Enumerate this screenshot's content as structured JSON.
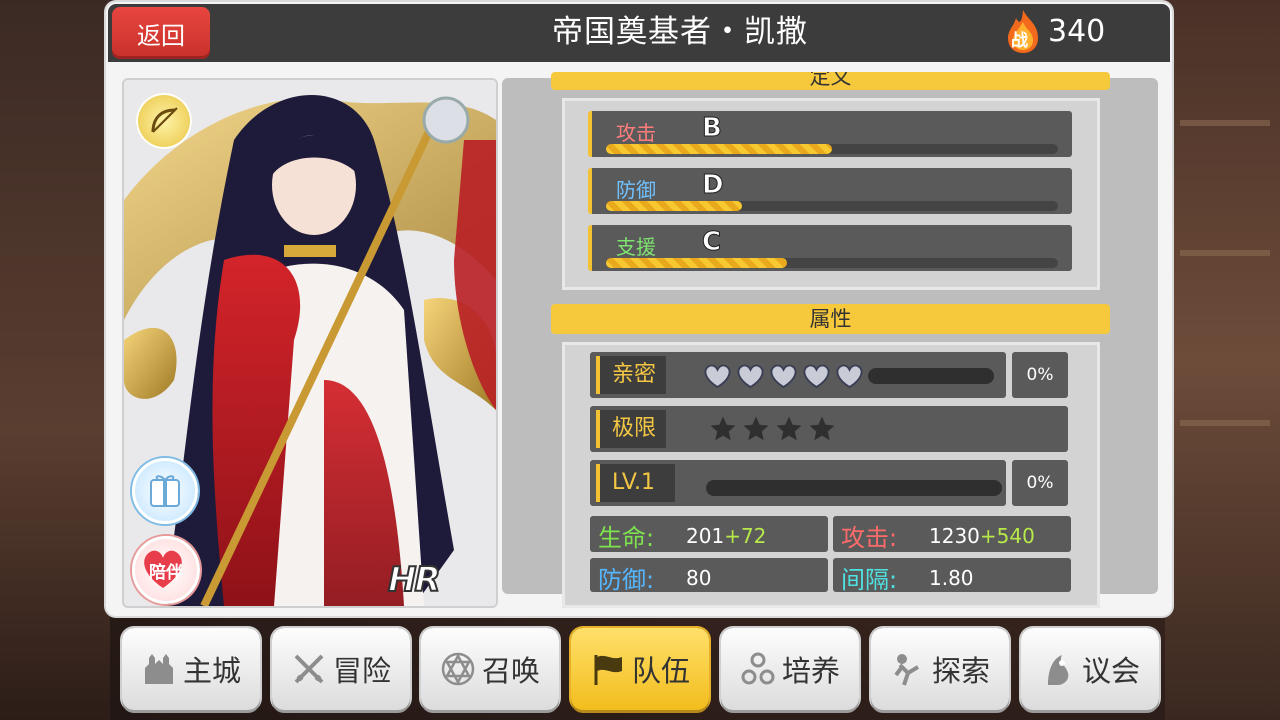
{
  "header": {
    "back_label": "返回",
    "title": "帝国奠基者・凯撒",
    "power_badge": "战",
    "power_value": "340"
  },
  "portrait": {
    "class_icon": "bow-icon",
    "gift_icon": "gift-icon",
    "accompany_label": "陪伴",
    "rarity": "HR"
  },
  "roles": {
    "section_title": "定义",
    "items": [
      {
        "label": "攻击",
        "grade": "B",
        "fill": 0.5,
        "color": "#ff7d7d"
      },
      {
        "label": "防御",
        "grade": "D",
        "fill": 0.3,
        "color": "#6fc2ff"
      },
      {
        "label": "支援",
        "grade": "C",
        "fill": 0.4,
        "color": "#7fe36f"
      }
    ]
  },
  "attributes": {
    "section_title": "属性",
    "intimacy": {
      "label": "亲密",
      "hearts": 5,
      "progress": 0.0,
      "percent": "0%"
    },
    "limit": {
      "label": "极限",
      "stars": 4
    },
    "level": {
      "label": "LV.1",
      "progress": 0.0,
      "percent": "0%"
    },
    "stats": [
      {
        "name": "生命:",
        "base": "201",
        "bonus": "+72",
        "color": "#7ee24f"
      },
      {
        "name": "攻击:",
        "base": "1230",
        "bonus": "+540",
        "color": "#ff6b6b"
      },
      {
        "name": "防御:",
        "base": "80",
        "bonus": "",
        "color": "#55b6ff"
      },
      {
        "name": "间隔:",
        "base": "1.80",
        "bonus": "",
        "color": "#4fe2e2"
      }
    ]
  },
  "nav": [
    {
      "label": "主城",
      "icon": "castle-icon",
      "active": false
    },
    {
      "label": "冒险",
      "icon": "crossed-swords-icon",
      "active": false
    },
    {
      "label": "召唤",
      "icon": "hexagram-icon",
      "active": false
    },
    {
      "label": "队伍",
      "icon": "team-flag-icon",
      "active": true
    },
    {
      "label": "培养",
      "icon": "training-icon",
      "active": false
    },
    {
      "label": "探索",
      "icon": "explore-icon",
      "active": false
    },
    {
      "label": "议会",
      "icon": "council-icon",
      "active": false
    }
  ]
}
